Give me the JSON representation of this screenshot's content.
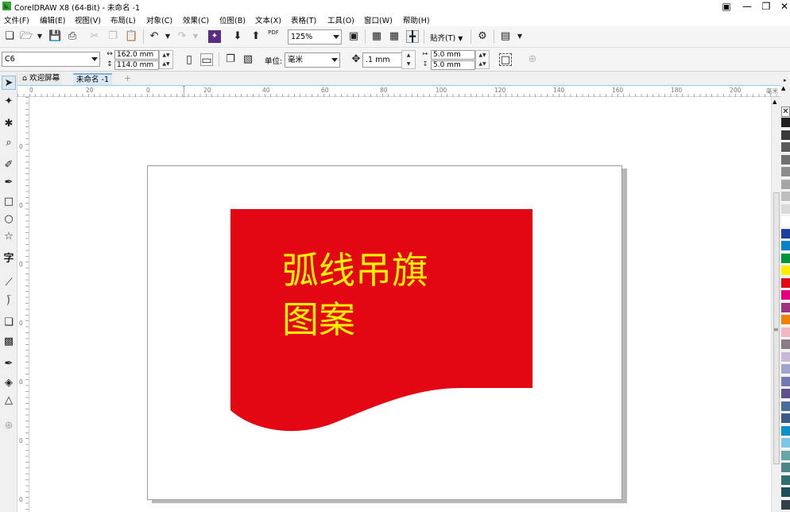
{
  "window": {
    "title": "CorelDRAW X8 (64-Bit) - 未命名 -1"
  },
  "menu": [
    "文件(F)",
    "编辑(E)",
    "视图(V)",
    "布局(L)",
    "对象(C)",
    "效果(C)",
    "位图(B)",
    "文本(X)",
    "表格(T)",
    "工具(O)",
    "窗口(W)",
    "帮助(H)"
  ],
  "toolbar": {
    "zoom": "125%",
    "pdf_label": "PDF",
    "snap_label": "贴齐(T)"
  },
  "property_bar": {
    "page_size": "C6",
    "width": "162.0 mm",
    "height": "114.0 mm",
    "units_label": "单位:",
    "units": "毫米",
    "nudge": ".1 mm",
    "dup_x": "5.0 mm",
    "dup_y": "5.0 mm"
  },
  "tabs": {
    "welcome": "欢迎屏幕",
    "document": "未命名 -1",
    "add": "+"
  },
  "ruler": {
    "h_labels": [
      "0",
      "20",
      "0",
      "20",
      "40",
      "60",
      "80",
      "100",
      "120",
      "140",
      "160",
      "180",
      "200"
    ],
    "v_labels": [
      "0",
      "0",
      "0",
      "0",
      "0",
      "0",
      "0"
    ],
    "unit": "毫米"
  },
  "artwork": {
    "text_lines": [
      "弧线吊旗",
      "图案"
    ],
    "flag_color": "#e30613",
    "text_color": "#fff100"
  },
  "palette": [
    "#231f20",
    "#3a3a3a",
    "#595959",
    "#707070",
    "#8c8c8c",
    "#a6a6a6",
    "#bfbfbf",
    "#d9d9d9",
    "#ffffff",
    "#1d3f9e",
    "#0a80c9",
    "#00953b",
    "#ffed00",
    "#e30613",
    "#e4007f",
    "#a1307f",
    "#ef8200",
    "#f4b6c2",
    "#8b7b86",
    "#c9b8d6",
    "#9fa5cf",
    "#7377b2",
    "#5f4f8e",
    "#4a6c9a",
    "#3c5a86",
    "#0c8ec9",
    "#7dc6ea",
    "#67a5a8",
    "#4d8489",
    "#2f6d6f",
    "#1d4f58",
    "#333f48"
  ]
}
